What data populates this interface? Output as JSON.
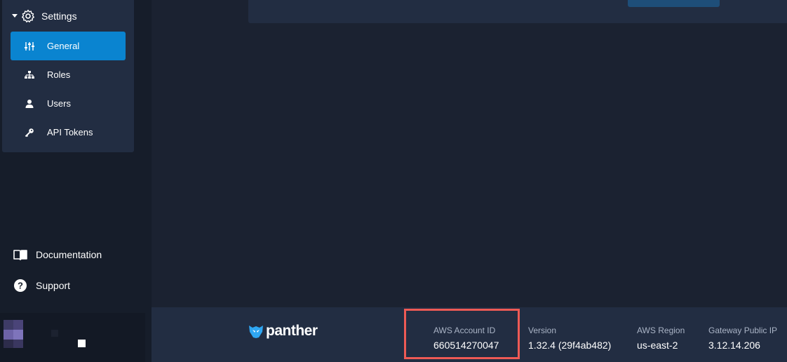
{
  "sidebar": {
    "settings_label": "Settings",
    "items": [
      {
        "label": "General",
        "icon": "sliders-icon"
      },
      {
        "label": "Roles",
        "icon": "hierarchy-icon"
      },
      {
        "label": "Users",
        "icon": "user-icon"
      },
      {
        "label": "API Tokens",
        "icon": "key-icon"
      }
    ],
    "active_item": "General",
    "documentation_label": "Documentation",
    "support_label": "Support"
  },
  "footer": {
    "logo_text": "panther",
    "aws_account_id_label": "AWS Account ID",
    "aws_account_id": "660514270047",
    "version_label": "Version",
    "version": "1.32.4 (29f4ab482)",
    "aws_region_label": "AWS Region",
    "aws_region": "us-east-2",
    "gateway_ip_label": "Gateway Public IP",
    "gateway_ip": "3.12.14.206"
  },
  "colors": {
    "background": "#1b2231",
    "sidebar": "#161d2a",
    "panel": "#222d42",
    "accent": "#0a84d0",
    "highlight": "#ee5a55"
  }
}
